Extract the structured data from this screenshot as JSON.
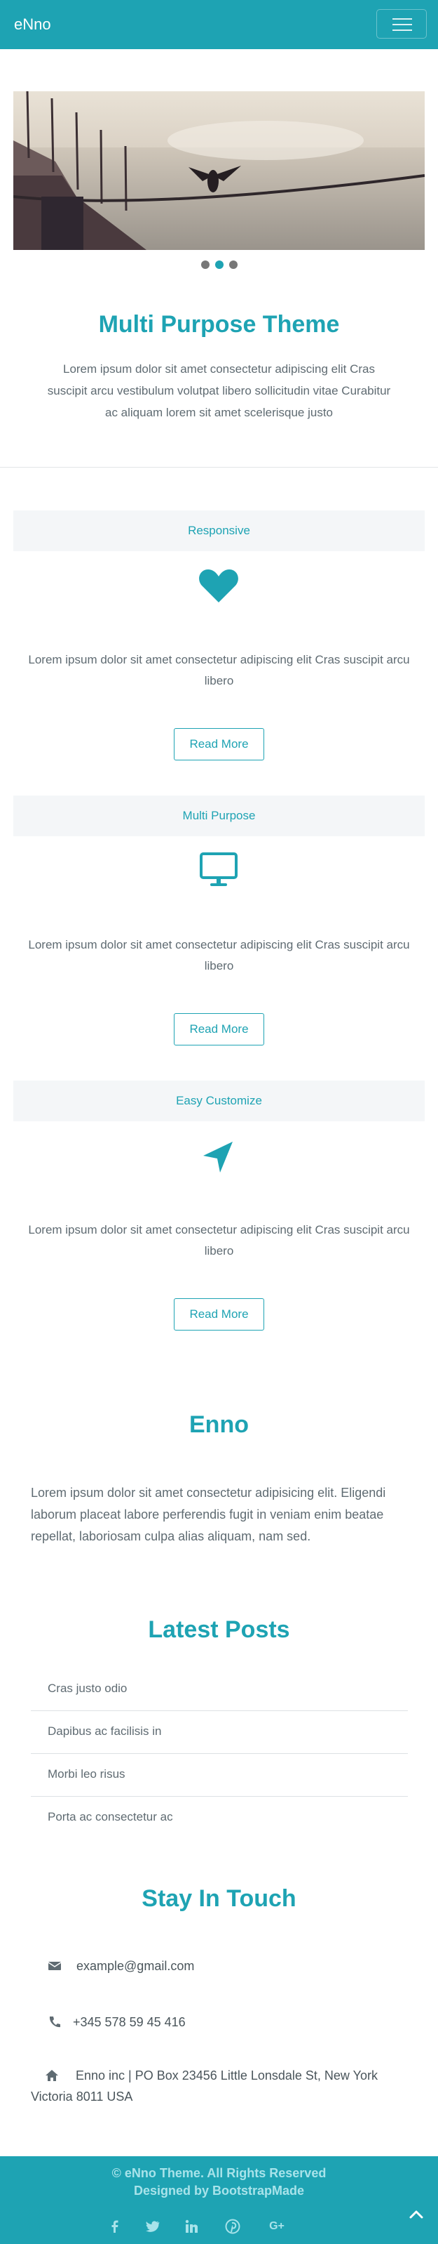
{
  "navbar": {
    "brand": "eNno"
  },
  "carousel": {
    "slide_count": 3,
    "active_index": 1
  },
  "intro": {
    "title": "Multi Purpose Theme",
    "text": "Lorem ipsum dolor sit amet consectetur adipiscing elit Cras suscipit arcu vestibulum volutpat libero sollicitudin vitae Curabitur ac aliquam lorem sit amet scelerisque justo"
  },
  "features": [
    {
      "title": "Responsive",
      "icon": "heart-icon",
      "text": "Lorem ipsum dolor sit amet consectetur adipiscing elit Cras suscipit arcu libero",
      "button": "Read More"
    },
    {
      "title": "Multi Purpose",
      "icon": "desktop-icon",
      "text": "Lorem ipsum dolor sit amet consectetur adipiscing elit Cras suscipit arcu libero",
      "button": "Read More"
    },
    {
      "title": "Easy Customize",
      "icon": "location-arrow-icon",
      "text": "Lorem ipsum dolor sit amet consectetur adipiscing elit Cras suscipit arcu libero",
      "button": "Read More"
    }
  ],
  "about": {
    "title": "Enno",
    "text": "Lorem ipsum dolor sit amet consectetur adipisicing elit. Eligendi laborum placeat labore perferendis fugit in veniam enim beatae repellat, laboriosam culpa alias aliquam, nam sed."
  },
  "posts": {
    "title": "Latest Posts",
    "items": [
      "Cras justo odio",
      "Dapibus ac facilisis in",
      "Morbi leo risus",
      "Porta ac consectetur ac"
    ]
  },
  "contact": {
    "title": "Stay In Touch",
    "email": "example@gmail.com",
    "phone": "+345 578 59 45 416",
    "address": "Enno inc | PO Box 23456 Little Lonsdale St, New York Victoria 8011 USA"
  },
  "footer": {
    "copyright": "© eNno Theme. All Rights Reserved",
    "designed_by": "Designed by BootstrapMade",
    "social": [
      "f",
      "twitter",
      "in",
      "pinterest",
      "G+"
    ]
  },
  "colors": {
    "accent": "#1ea3b3",
    "footer_text": "#a8e3ea",
    "card_bg": "#f4f6f8"
  }
}
